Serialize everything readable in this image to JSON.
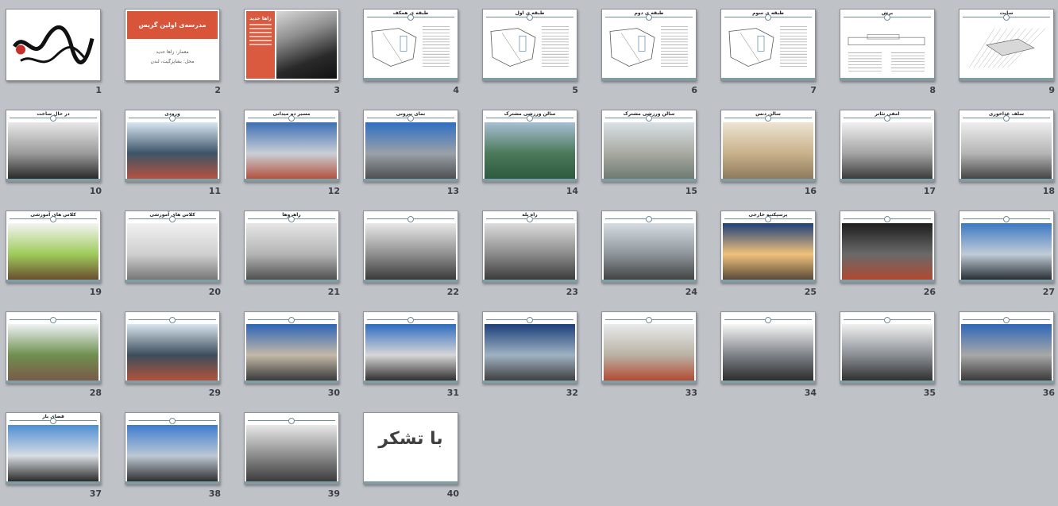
{
  "app": {
    "view": "Slide Sorter"
  },
  "slides": [
    {
      "number": "1",
      "title": "",
      "kind": "calligraphy"
    },
    {
      "number": "2",
      "title": "مدرسه‌ی اولین گریس",
      "kind": "title",
      "subtitle1": "معمار: زاها حدید",
      "subtitle2": "محل: بشاپزگیت، لندن"
    },
    {
      "number": "3",
      "title": "زاها حدید",
      "kind": "bio"
    },
    {
      "number": "4",
      "title": "طبقه ی همکف",
      "kind": "plan"
    },
    {
      "number": "5",
      "title": "طبقه ی اول",
      "kind": "plan"
    },
    {
      "number": "6",
      "title": "طبقه ی دوم",
      "kind": "plan"
    },
    {
      "number": "7",
      "title": "طبقه ی سوم",
      "kind": "plan"
    },
    {
      "number": "8",
      "title": "برش",
      "kind": "section"
    },
    {
      "number": "9",
      "title": "سایت",
      "kind": "site"
    },
    {
      "number": "10",
      "title": "در حال ساخت",
      "kind": "photo",
      "colors": [
        "#e8e8e8",
        "#9a9a9a",
        "#2a2a2a"
      ]
    },
    {
      "number": "11",
      "title": "ورودی",
      "kind": "photo",
      "colors": [
        "#d8e6f2",
        "#3d5467",
        "#b5523f"
      ]
    },
    {
      "number": "12",
      "title": "مسیر دو میدانی",
      "kind": "photo",
      "colors": [
        "#3d6fb3",
        "#c9cfd6",
        "#b5523f"
      ]
    },
    {
      "number": "13",
      "title": "نمای بیرونی",
      "kind": "photo",
      "colors": [
        "#2e6fc3",
        "#9aa1a8",
        "#4e4f52"
      ]
    },
    {
      "number": "14",
      "title": "سالن ورزشی مشترک",
      "kind": "photo",
      "colors": [
        "#a7bed4",
        "#4b7a59",
        "#2e5a3f"
      ]
    },
    {
      "number": "15",
      "title": "سالن ورزشی مشترک",
      "kind": "photo",
      "colors": [
        "#d9e1e6",
        "#a7aaa1",
        "#6f7a72"
      ]
    },
    {
      "number": "16",
      "title": "سالن دنس",
      "kind": "photo",
      "colors": [
        "#ede4d2",
        "#c9b18b",
        "#8e7a5c"
      ]
    },
    {
      "number": "17",
      "title": "امفی تئاتر",
      "kind": "photo",
      "colors": [
        "#f0f0f0",
        "#a4a4a4",
        "#3b3b3b"
      ]
    },
    {
      "number": "18",
      "title": "سلف غذاخوری",
      "kind": "photo",
      "colors": [
        "#eeeeee",
        "#b5b5b5",
        "#454545"
      ]
    },
    {
      "number": "19",
      "title": "کلاس های آموزشی",
      "kind": "photo",
      "colors": [
        "#f4f4f4",
        "#9ecb5a",
        "#6b4f2f"
      ]
    },
    {
      "number": "20",
      "title": "کلاس های آموزشی",
      "kind": "photo",
      "colors": [
        "#f1f1f1",
        "#cfcfcf",
        "#777777"
      ]
    },
    {
      "number": "21",
      "title": "راهروها",
      "kind": "photo",
      "colors": [
        "#e6e6e6",
        "#b4b4b4",
        "#505050"
      ]
    },
    {
      "number": "22",
      "title": "",
      "kind": "photo",
      "colors": [
        "#e8e8e8",
        "#8f8f8f",
        "#3a3a3a"
      ]
    },
    {
      "number": "23",
      "title": "راه پله",
      "kind": "photo",
      "colors": [
        "#dcdcdc",
        "#8a8a8a",
        "#3c3c3c"
      ]
    },
    {
      "number": "24",
      "title": "",
      "kind": "photo",
      "colors": [
        "#d6dde2",
        "#8d949a",
        "#444444"
      ]
    },
    {
      "number": "25",
      "title": "پرسپکتیو خارجی",
      "kind": "photo",
      "colors": [
        "#1d3f7a",
        "#f0c27a",
        "#5a4a3a"
      ]
    },
    {
      "number": "26",
      "title": "",
      "kind": "photo",
      "colors": [
        "#1e1e1e",
        "#6a6a6a",
        "#b04a30"
      ]
    },
    {
      "number": "27",
      "title": "",
      "kind": "photo",
      "colors": [
        "#3b78c2",
        "#c0ccd6",
        "#2a2f36"
      ]
    },
    {
      "number": "28",
      "title": "",
      "kind": "photo",
      "colors": [
        "#eef2f4",
        "#6f8f4f",
        "#7a5a48"
      ]
    },
    {
      "number": "29",
      "title": "",
      "kind": "photo",
      "colors": [
        "#d8e4ee",
        "#3d4d5b",
        "#b1533c"
      ]
    },
    {
      "number": "30",
      "title": "",
      "kind": "photo",
      "colors": [
        "#2c64b6",
        "#c3b9a8",
        "#3a3a3a"
      ]
    },
    {
      "number": "31",
      "title": "",
      "kind": "photo",
      "colors": [
        "#2d6cc0",
        "#d7d7d7",
        "#303030"
      ]
    },
    {
      "number": "32",
      "title": "",
      "kind": "photo",
      "colors": [
        "#1c3f7a",
        "#9fb2c2",
        "#404040"
      ]
    },
    {
      "number": "33",
      "title": "",
      "kind": "photo",
      "colors": [
        "#e8eaec",
        "#b9b2a4",
        "#b44a33"
      ]
    },
    {
      "number": "34",
      "title": "",
      "kind": "photo",
      "colors": [
        "#f6f6f6",
        "#7d8288",
        "#2c2c2c"
      ]
    },
    {
      "number": "35",
      "title": "",
      "kind": "photo",
      "colors": [
        "#f0f0f0",
        "#8a8f95",
        "#303030"
      ]
    },
    {
      "number": "36",
      "title": "",
      "kind": "photo",
      "colors": [
        "#2f67b6",
        "#a8a8a8",
        "#3a3a3a"
      ]
    },
    {
      "number": "37",
      "title": "فضای باز",
      "kind": "photo",
      "colors": [
        "#4f8fd4",
        "#d7dde2",
        "#2b2b2b"
      ]
    },
    {
      "number": "38",
      "title": "",
      "kind": "photo",
      "colors": [
        "#3d7bd0",
        "#bcc8d3",
        "#2f2f2f"
      ]
    },
    {
      "number": "39",
      "title": "",
      "kind": "photo",
      "colors": [
        "#e8e8e8",
        "#8a8a8a",
        "#3c3c3c"
      ]
    },
    {
      "number": "40",
      "title": "با تشکر",
      "kind": "thanks"
    }
  ]
}
